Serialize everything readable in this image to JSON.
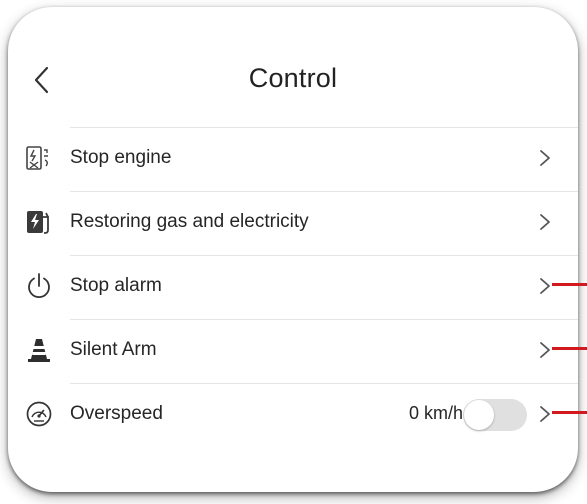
{
  "header": {
    "title": "Control",
    "back_icon": "chevron-left-icon"
  },
  "items": [
    {
      "label": "Stop engine",
      "icon": "engine-stop-icon"
    },
    {
      "label": "Restoring gas and electricity",
      "icon": "fuel-electricity-icon"
    },
    {
      "label": "Stop alarm",
      "icon": "power-icon"
    },
    {
      "label": "Silent Arm",
      "icon": "traffic-cone-icon"
    },
    {
      "label": "Overspeed",
      "icon": "speedometer-icon",
      "value": "0 km/h",
      "toggle_on": false
    }
  ],
  "colors": {
    "marker": "#d2191e",
    "text": "#262626",
    "toggle_off": "#e0e0e0"
  }
}
